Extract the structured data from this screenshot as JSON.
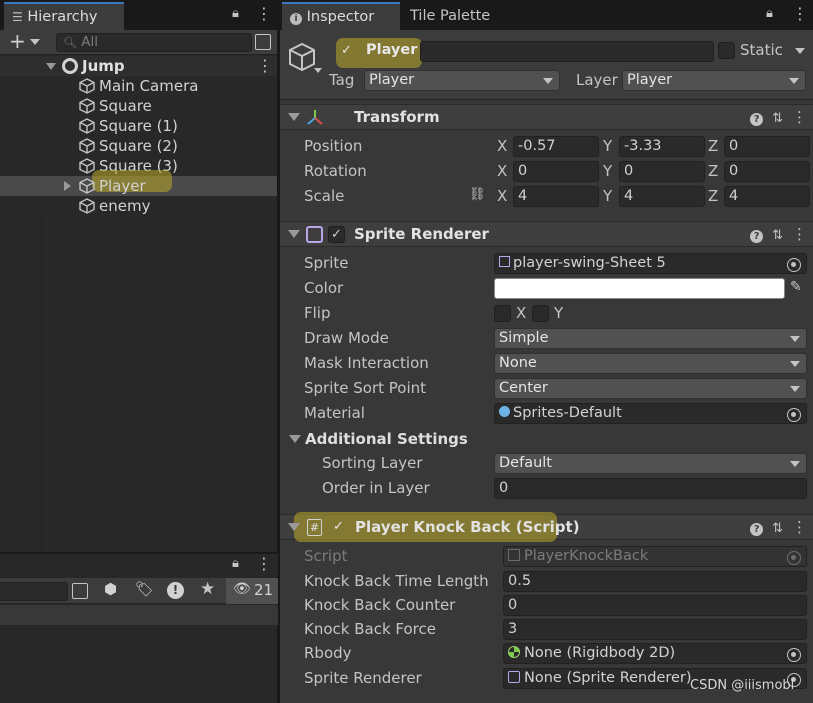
{
  "hierarchy": {
    "tab_label": "Hierarchy",
    "search_placeholder": "All",
    "scene_name": "Jump",
    "items": [
      "Main Camera",
      "Square",
      "Square (1)",
      "Square (2)",
      "Square (3)",
      "Player",
      "enemy"
    ],
    "selected_item": "Player"
  },
  "project": {
    "hidden_count": "21"
  },
  "inspector": {
    "tab_label": "Inspector",
    "tab2_label": "Tile Palette",
    "object_name": "Player",
    "static_label": "Static",
    "tag_label": "Tag",
    "tag_value": "Player",
    "layer_label": "Layer",
    "layer_value": "Player",
    "transform": {
      "title": "Transform",
      "position_label": "Position",
      "rotation_label": "Rotation",
      "scale_label": "Scale",
      "axis_x": "X",
      "axis_y": "Y",
      "axis_z": "Z",
      "position": [
        "-0.57",
        "-3.33",
        "0"
      ],
      "rotation": [
        "0",
        "0",
        "0"
      ],
      "scale": [
        "4",
        "4",
        "4"
      ]
    },
    "sprite_renderer": {
      "title": "Sprite Renderer",
      "sprite_label": "Sprite",
      "sprite_value": "player-swing-Sheet 5",
      "color_label": "Color",
      "color_value": "#ffffff",
      "flip_label": "Flip",
      "flip_x": "X",
      "flip_y": "Y",
      "draw_mode_label": "Draw Mode",
      "draw_mode_value": "Simple",
      "mask_label": "Mask Interaction",
      "mask_value": "None",
      "sort_point_label": "Sprite Sort Point",
      "sort_point_value": "Center",
      "material_label": "Material",
      "material_value": "Sprites-Default",
      "additional_label": "Additional Settings",
      "sorting_layer_label": "Sorting Layer",
      "sorting_layer_value": "Default",
      "order_label": "Order in Layer",
      "order_value": "0"
    },
    "knockback": {
      "title": "Player Knock Back (Script)",
      "script_label": "Script",
      "script_value": "PlayerKnockBack",
      "time_label": "Knock Back Time Length",
      "time_value": "0.5",
      "counter_label": "Knock Back Counter",
      "counter_value": "0",
      "force_label": "Knock Back Force",
      "force_value": "3",
      "rbody_label": "Rbody",
      "rbody_value": "None (Rigidbody 2D)",
      "sr_label": "Sprite Renderer",
      "sr_value": "None (Sprite Renderer)"
    }
  },
  "watermark": "CSDN @iiismobl",
  "colors": {
    "highlight": "#bea828",
    "accent": "#3a79bb"
  }
}
